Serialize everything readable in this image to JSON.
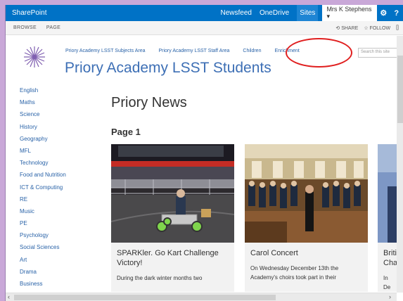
{
  "suitebar": {
    "brand": "SharePoint",
    "links": [
      "Newsfeed",
      "OneDrive",
      "Sites"
    ],
    "user": "Mrs K Stephens ▾",
    "gear": "⚙",
    "help": "?"
  },
  "ribbon": {
    "tabs": [
      "BROWSE",
      "PAGE"
    ],
    "share": "SHARE",
    "follow": "FOLLOW",
    "focus": "[]"
  },
  "header": {
    "nav": [
      "Priory Academy LSST Subjects Area",
      "Priory Academy LSST Staff Area",
      "Children",
      "Enrichment"
    ],
    "title": "Priory Academy LSST Students",
    "search_placeholder": "Search this site"
  },
  "leftnav": [
    "English",
    "Maths",
    "Science",
    "History",
    "Geography",
    "MFL",
    "Technology",
    "Food and Nutrition",
    "ICT & Computing",
    "RE",
    "Music",
    "PE",
    "Psychology",
    "Social Sciences",
    "Art",
    "Drama",
    "Business"
  ],
  "main": {
    "news_title": "Priory News",
    "page_heading": "Page 1",
    "cards": [
      {
        "title": "SPARKler. Go Kart Challenge Victory!",
        "body": "During the dark winter months two"
      },
      {
        "title": "Carol Concert",
        "body": "On Wednesday December 13th the Academy's choirs took part in their"
      },
      {
        "title": "Britis Cha",
        "body": "In De"
      }
    ]
  },
  "colors": {
    "suite_bar": "#0072c6",
    "link": "#2a63a8",
    "annotation": "#e01f1f"
  }
}
